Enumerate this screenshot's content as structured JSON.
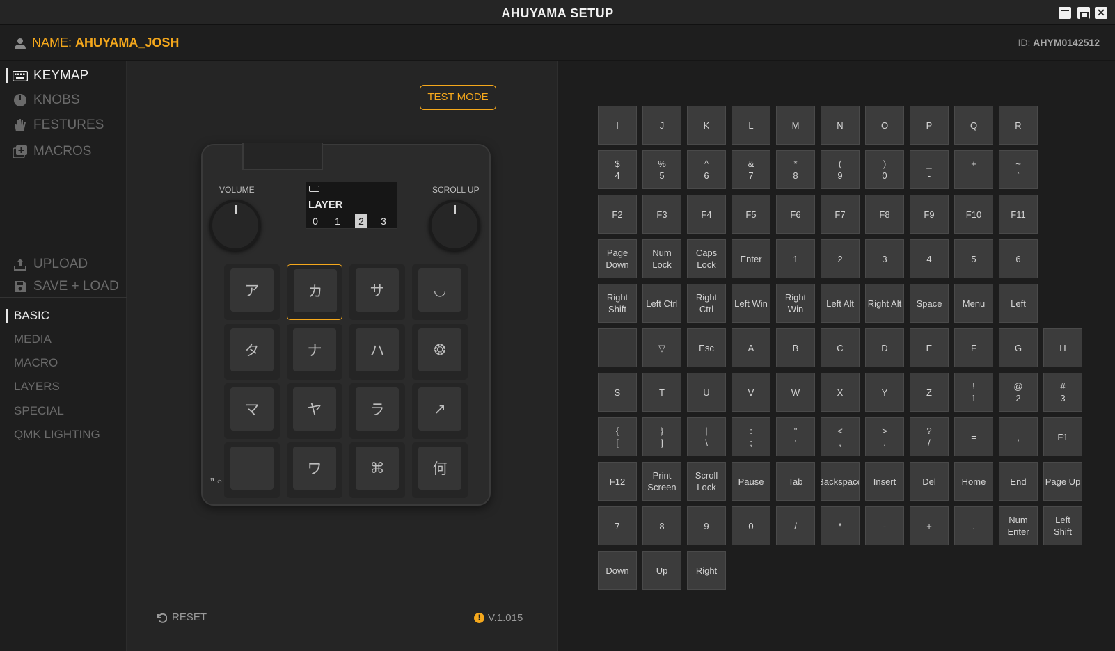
{
  "app": {
    "title": "AHUYAMA SETUP"
  },
  "user": {
    "name_label": "NAME:",
    "name_value": "AHUYAMA_JOSH",
    "id_label": "ID:",
    "id_value": "AHYM0142512"
  },
  "nav": {
    "items": [
      {
        "label": "KEYMAP",
        "icon": "keyboard-icon"
      },
      {
        "label": "KNOBS",
        "icon": "knob-icon"
      },
      {
        "label": "FESTURES",
        "icon": "hand-icon"
      },
      {
        "label": "MACROS",
        "icon": "macro-icon"
      }
    ],
    "upload": "UPLOAD",
    "save_load": "SAVE + LOAD"
  },
  "categories": [
    "BASIC",
    "MEDIA",
    "MACRO",
    "LAYERS",
    "SPECIAL",
    "QMK LIGHTING"
  ],
  "device": {
    "test_mode": "TEST MODE",
    "left_knob": "VOLUME",
    "right_knob": "SCROLL UP",
    "oled_title": "LAYER",
    "layers": [
      "0",
      "1",
      "2",
      "3"
    ],
    "selected_layer": "2",
    "pads": [
      "ア",
      "カ",
      "サ",
      "◡",
      "タ",
      "ナ",
      "ハ",
      "❂",
      "マ",
      "ヤ",
      "ラ",
      "↗",
      "",
      "ワ",
      "⌘",
      "何"
    ],
    "selected_pad": 1,
    "bottom_left_glyphs": "❞ ○"
  },
  "footer": {
    "reset": "RESET",
    "version": "V.1.015"
  },
  "keys": [
    [
      "I",
      "J",
      "K",
      "L",
      "M",
      "N",
      "O",
      "P",
      "Q",
      "R"
    ],
    [
      "$\n4",
      "%\n5",
      "^\n6",
      "&\n7",
      "*\n8",
      "(\n9",
      ")\n0",
      "_\n-",
      "+\n=",
      "~\n`"
    ],
    [
      "F2",
      "F3",
      "F4",
      "F5",
      "F6",
      "F7",
      "F8",
      "F9",
      "F10",
      "F11"
    ],
    [
      "Page\nDown",
      "Num\nLock",
      "Caps\nLock",
      "Enter",
      "1",
      "2",
      "3",
      "4",
      "5",
      "6"
    ],
    [
      "Right\nShift",
      "Left Ctrl",
      "Right\nCtrl",
      "Left Win",
      "Right\nWin",
      "Left Alt",
      "Right Alt",
      "Space",
      "Menu",
      "Left"
    ],
    [
      "",
      "▽",
      "Esc",
      "A",
      "B",
      "C",
      "D",
      "E",
      "F",
      "G",
      "H"
    ],
    [
      "S",
      "T",
      "U",
      "V",
      "W",
      "X",
      "Y",
      "Z",
      "!\n1",
      "@\n2",
      "#\n3"
    ],
    [
      "{\n[",
      "}\n]",
      "|\n\\",
      ":\n;",
      "\"\n'",
      "<\n,",
      ">\n.",
      "?\n/",
      "=",
      ",",
      "F1"
    ],
    [
      "F12",
      "Print\nScreen",
      "Scroll\nLock",
      "Pause",
      "Tab",
      "Backspace",
      "Insert",
      "Del",
      "Home",
      "End",
      "Page Up"
    ],
    [
      "7",
      "8",
      "9",
      "0",
      "/",
      "*",
      "-",
      "+",
      ".",
      "Num\nEnter",
      "Left\nShift"
    ],
    [
      "Down",
      "Up",
      "Right"
    ]
  ],
  "colors": {
    "accent": "#f5a81c",
    "background": "#1e1e1e",
    "key": "#3c3c3c"
  }
}
